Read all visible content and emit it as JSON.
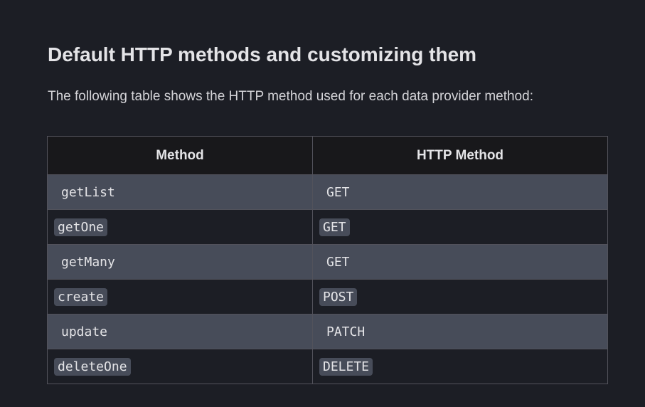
{
  "heading": "Default HTTP methods and customizing them",
  "intro": "The following table shows the HTTP method used for each data provider method:",
  "table": {
    "headers": [
      "Method",
      "HTTP Method"
    ],
    "rows": [
      {
        "method": "getList",
        "http": "GET"
      },
      {
        "method": "getOne",
        "http": "GET"
      },
      {
        "method": "getMany",
        "http": "GET"
      },
      {
        "method": "create",
        "http": "POST"
      },
      {
        "method": "update",
        "http": "PATCH"
      },
      {
        "method": "deleteOne",
        "http": "DELETE"
      }
    ]
  },
  "colors": {
    "background": "#1c1e25",
    "header_bg": "#18181b",
    "stripe_bg": "#474c59",
    "border": "#52525b"
  }
}
